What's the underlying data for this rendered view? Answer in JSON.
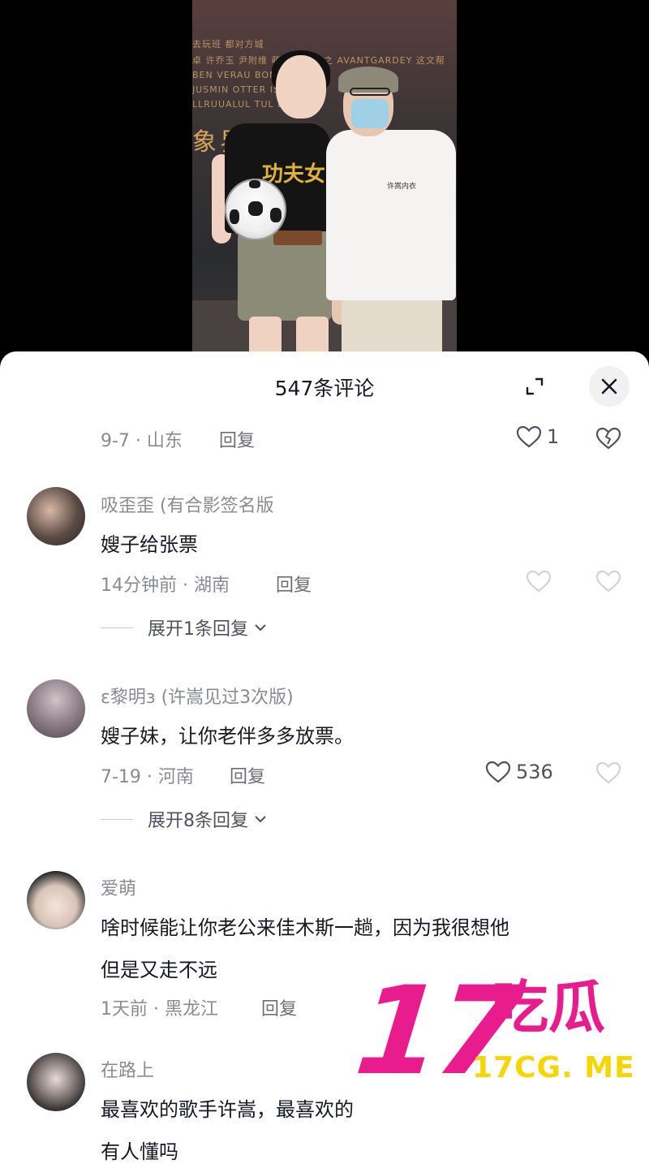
{
  "photo": {
    "backdrop_lines": [
      "去玩班 都对方城",
      "卓 许乔玉 尹附维 萌莱莱 阳邦之 AVANTGARDEY 这文帮",
      "BEN VERAU BOND HUNA",
      "JUSMIN OTTER ISOBAD",
      "LLRUUALUL TUL DUU"
    ],
    "backdrop_title": "象界 万 城",
    "shirt_print": "功夫女",
    "man_shirt_print": "许嵩内衣"
  },
  "header": {
    "title": "547条评论"
  },
  "comments": [
    {
      "meta": "9-7 · 山东",
      "reply": "回复",
      "likes": "1"
    },
    {
      "name": "吸歪歪 (有合影签名版",
      "text": "嫂子给张票",
      "meta": "14分钟前 · 湖南",
      "reply": "回复",
      "expand": "展开1条回复"
    },
    {
      "name": "ε黎明з (许嵩见过3次版)",
      "text": "嫂子妹，让你老伴多多放票。",
      "meta": "7-19 · 河南",
      "reply": "回复",
      "likes": "536",
      "expand": "展开8条回复"
    },
    {
      "name": "爱萌",
      "text_line1": "啥时候能让你老公来佳木斯一趟，因为我很想他",
      "text_line2": "但是又走不远",
      "meta": "1天前 · 黑龙江",
      "reply": "回复"
    },
    {
      "name": "在路上",
      "text_line1": "最喜欢的歌手许嵩，最喜欢的",
      "text_line2": "有人懂吗"
    }
  ],
  "watermark": {
    "number": "17",
    "brand": "吃瓜",
    "url": "17CG. ME"
  },
  "colors": {
    "watermark_pink": "#e81c8d",
    "watermark_yellow": "#f6d600",
    "text_primary": "#161823",
    "text_secondary": "#8a8b91"
  }
}
